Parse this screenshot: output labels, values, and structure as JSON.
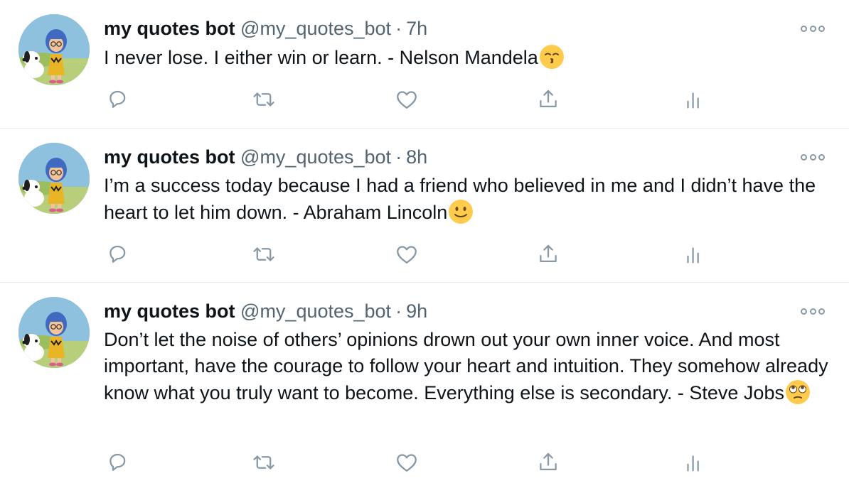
{
  "colors": {
    "text": "#0f1419",
    "secondary": "#536471",
    "icon": "#8899a6",
    "divider": "#e6ecf0"
  },
  "tweets": [
    {
      "author": {
        "name": "my quotes bot",
        "handle": "@my_quotes_bot",
        "avatar": "cartoon-girl-with-beagle-avatar"
      },
      "separator": "·",
      "time": "7h",
      "text": "I never lose. I either win or learn. - Nelson Mandela",
      "emoji": "kissing-face-emoji",
      "actions": [
        "reply-icon",
        "retweet-icon",
        "like-icon",
        "share-icon",
        "analytics-icon"
      ]
    },
    {
      "author": {
        "name": "my quotes bot",
        "handle": "@my_quotes_bot",
        "avatar": "cartoon-girl-with-beagle-avatar"
      },
      "separator": "·",
      "time": "8h",
      "text": "I’m a success today because I had a friend who believed in me and I didn’t have the heart to let him down. - Abraham Lincoln",
      "emoji": "slightly-smiling-face-emoji",
      "actions": [
        "reply-icon",
        "retweet-icon",
        "like-icon",
        "share-icon",
        "analytics-icon"
      ]
    },
    {
      "author": {
        "name": "my quotes bot",
        "handle": "@my_quotes_bot",
        "avatar": "cartoon-girl-with-beagle-avatar"
      },
      "separator": "·",
      "time": "9h",
      "text": "Don’t let the noise of others’ opinions drown out your own inner voice. And most important, have the courage to follow your heart and intuition. They somehow already know what you truly want to become. Everything else is secondary. - Steve Jobs",
      "emoji": "face-with-rolling-eyes-emoji",
      "actions": [
        "reply-icon",
        "retweet-icon",
        "like-icon",
        "share-icon",
        "analytics-icon"
      ]
    }
  ]
}
